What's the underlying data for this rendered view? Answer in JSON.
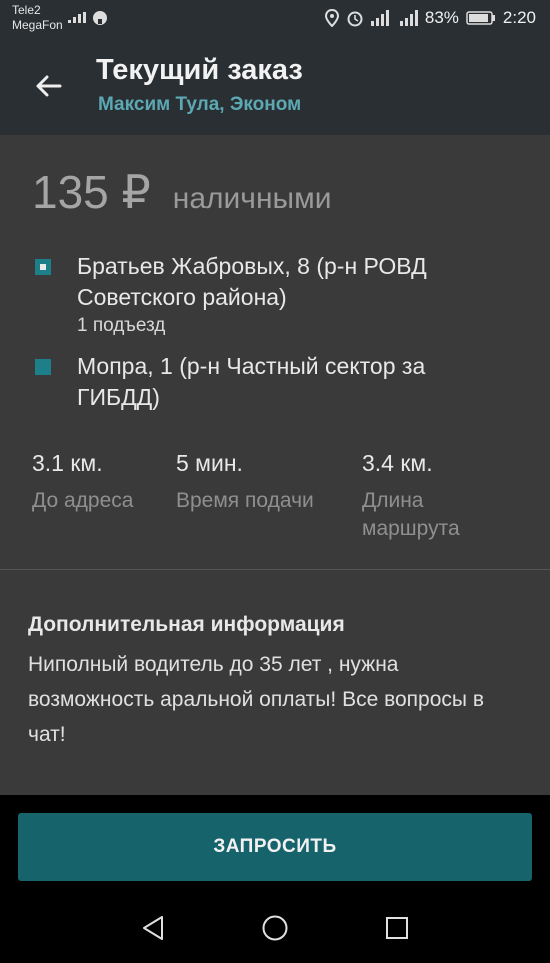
{
  "status_bar": {
    "carrier_line1": "Tele2",
    "carrier_line2": "MegaFon",
    "battery": "83%",
    "time": "2:20",
    "icons": [
      "wifi-icon",
      "android-icon",
      "location-icon",
      "alarm-icon",
      "signal-icon",
      "signal-4g-icon",
      "battery-icon"
    ]
  },
  "header": {
    "title": "Текущий заказ",
    "subtitle": "Максим Тула, Эконом",
    "back_icon": "arrow-left-icon"
  },
  "order": {
    "price": "135 ₽",
    "payment": "наличными",
    "pickup": {
      "address": "Братьев Жабровых, 8 (р-н РОВД Советского района)",
      "note": "1 подъезд"
    },
    "destination": {
      "address": "Мопра, 1 (р-н Частный сектор за ГИБДД)"
    },
    "stats": [
      {
        "value": "3.1 км.",
        "label": "До адреса"
      },
      {
        "value": "5 мин.",
        "label": "Время подачи"
      },
      {
        "value": "3.4 км.",
        "label": "Длина маршрута"
      }
    ],
    "info_title": "Дополнительная информация",
    "info_text": "Ниполный водитель до 35 лет , нужна возможность аральной оплаты! Все вопросы в чат!"
  },
  "actions": {
    "request_label": "ЗАПРОСИТЬ"
  },
  "colors": {
    "accent": "#17636c",
    "subtitle": "#5ca9b4",
    "background": "#3a3a3a"
  }
}
